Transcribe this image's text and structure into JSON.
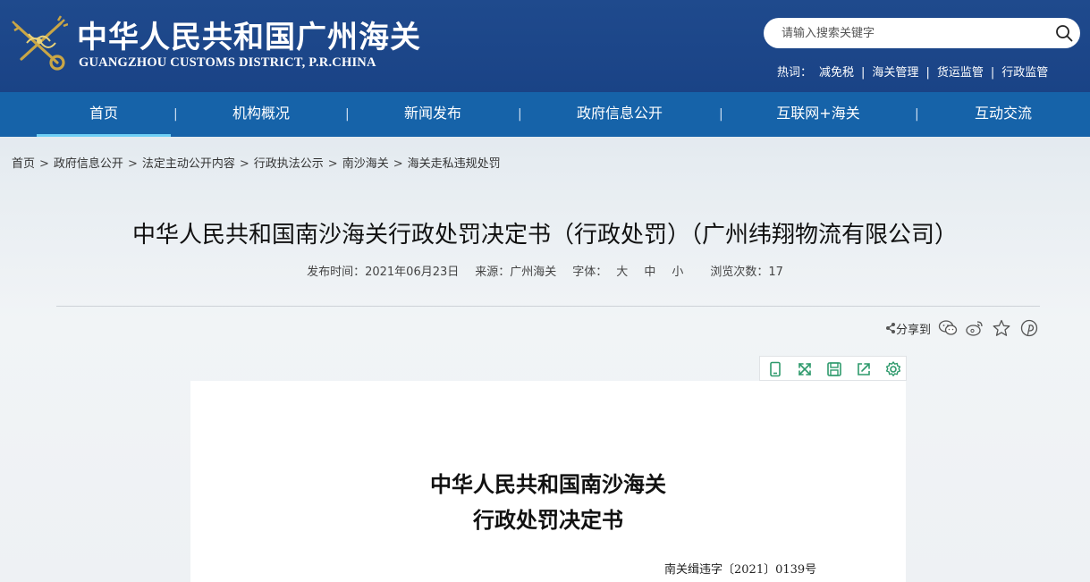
{
  "header": {
    "site_title": "中华人民共和国广州海关",
    "site_subtitle": "GUANGZHOU CUSTOMS DISTRICT, P.R.CHINA",
    "logo_icon": "customs-emblem-icon",
    "search": {
      "placeholder": "请输入搜索关键字",
      "value": "",
      "icon": "search-icon"
    },
    "hotwords": {
      "label": "热词：",
      "items": [
        "减免税",
        "海关管理",
        "货运监管",
        "行政监管"
      ]
    },
    "colors": {
      "header_bg": "#1f4a8d",
      "nav_bg": "#1663a9",
      "active_underline": "#6ecff6"
    }
  },
  "nav": {
    "items": [
      "首页",
      "机构概况",
      "新闻发布",
      "政府信息公开",
      "互联网+海关",
      "互动交流"
    ],
    "active_index": 0
  },
  "breadcrumb": [
    "首页",
    "政府信息公开",
    "法定主动公开内容",
    "行政执法公示",
    "南沙海关",
    "海关走私违规处罚"
  ],
  "article": {
    "title": "中华人民共和国南沙海关行政处罚决定书（行政处罚）（广州纬翔物流有限公司）",
    "meta": {
      "publish": "发布时间：2021年06月23日",
      "source": "来源：广州海关",
      "font_label": "字体：",
      "font_sizes": [
        "大",
        "中",
        "小"
      ],
      "views": "浏览次数：17"
    },
    "share": {
      "label": "分享到",
      "icons": [
        "share-nodes-icon",
        "wechat-icon",
        "weibo-icon",
        "favorite-star-icon",
        "pinterest-icon"
      ]
    }
  },
  "viewer": {
    "toolbar_icons": [
      "single-page-icon",
      "fullscreen-icon",
      "save-icon",
      "export-icon",
      "settings-icon"
    ],
    "toolbar_color": "#2e9a6c",
    "doc": {
      "heading_line1": "中华人民共和国南沙海关",
      "heading_line2": "行政处罚决定书",
      "doc_number": "南关缉违字〔2021〕0139号"
    }
  }
}
